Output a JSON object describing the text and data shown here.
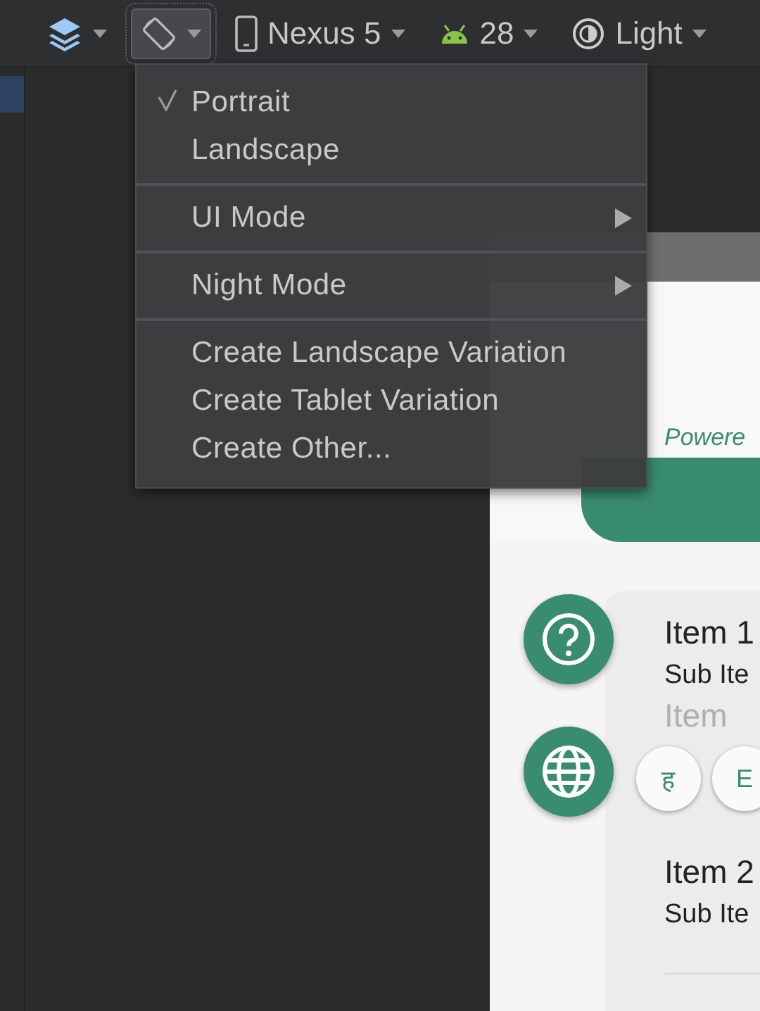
{
  "toolbar": {
    "items": [
      {
        "kind": "layers",
        "pressed": false
      },
      {
        "kind": "orientation",
        "pressed": true
      },
      {
        "kind": "device",
        "text": "Nexus 5",
        "pressed": false
      },
      {
        "kind": "api",
        "text": "28",
        "pressed": false
      },
      {
        "kind": "theme",
        "text": "Light",
        "pressed": false
      }
    ]
  },
  "menu": {
    "groups": [
      [
        {
          "label": "Portrait",
          "kind": "check",
          "checked": true
        },
        {
          "label": "Landscape",
          "kind": "check",
          "checked": false
        }
      ],
      [
        {
          "label": "UI Mode",
          "kind": "submenu"
        }
      ],
      [
        {
          "label": "Night Mode",
          "kind": "submenu"
        }
      ],
      [
        {
          "label": "Create Landscape Variation",
          "kind": "action"
        },
        {
          "label": "Create Tablet Variation",
          "kind": "action"
        },
        {
          "label": "Create Other...",
          "kind": "action"
        }
      ]
    ]
  },
  "preview": {
    "powered_text": "Powere",
    "list": [
      {
        "title": "Item 1",
        "subtitle": "Sub Ite",
        "ghost": "Item"
      },
      {
        "title": "Item 2",
        "subtitle": "Sub Ite"
      }
    ],
    "chips": [
      "ह",
      "E"
    ]
  }
}
